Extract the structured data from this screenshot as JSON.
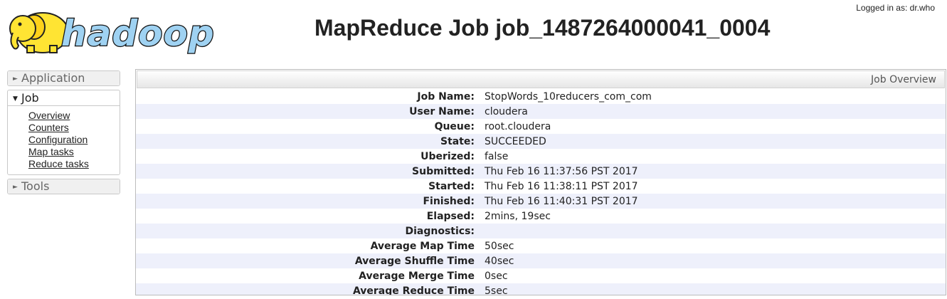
{
  "header": {
    "logo_text": "hadoop",
    "title": "MapReduce Job job_1487264000041_0004",
    "user_info": "Logged in as: dr.who"
  },
  "sidebar": {
    "sections": [
      {
        "label": "Application",
        "expanded": false,
        "icon": "triangle-right-icon"
      },
      {
        "label": "Job",
        "expanded": true,
        "icon": "triangle-down-icon",
        "links": [
          "Overview",
          "Counters",
          "Configuration",
          "Map tasks",
          "Reduce tasks"
        ]
      },
      {
        "label": "Tools",
        "expanded": false,
        "icon": "triangle-right-icon"
      }
    ]
  },
  "overview": {
    "header": "Job Overview",
    "rows": [
      {
        "label": "Job Name:",
        "value": "StopWords_10reducers_com_com"
      },
      {
        "label": "User Name:",
        "value": "cloudera"
      },
      {
        "label": "Queue:",
        "value": "root.cloudera"
      },
      {
        "label": "State:",
        "value": "SUCCEEDED"
      },
      {
        "label": "Uberized:",
        "value": "false"
      },
      {
        "label": "Submitted:",
        "value": "Thu Feb 16 11:37:56 PST 2017"
      },
      {
        "label": "Started:",
        "value": "Thu Feb 16 11:38:11 PST 2017"
      },
      {
        "label": "Finished:",
        "value": "Thu Feb 16 11:40:31 PST 2017"
      },
      {
        "label": "Elapsed:",
        "value": "2mins, 19sec"
      },
      {
        "label": "Diagnostics:",
        "value": ""
      },
      {
        "label": "Average Map Time",
        "value": "50sec"
      },
      {
        "label": "Average Shuffle Time",
        "value": "40sec"
      },
      {
        "label": "Average Merge Time",
        "value": "0sec"
      },
      {
        "label": "Average Reduce Time",
        "value": "5sec"
      }
    ]
  },
  "colors": {
    "logo_elephant": "#ffe433",
    "logo_text_fill": "#9fd2f2",
    "row_stripe": "#eef0fb"
  }
}
